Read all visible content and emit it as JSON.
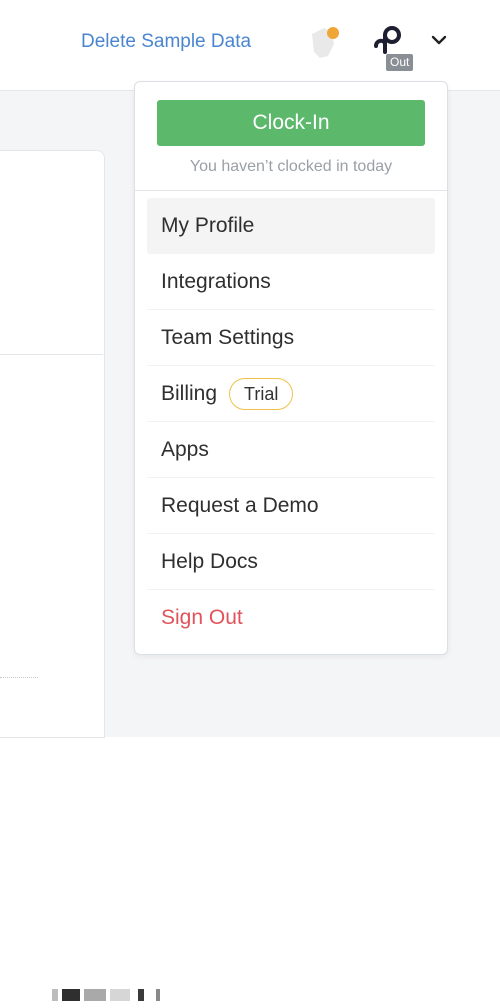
{
  "header": {
    "delete_sample_data": "Delete Sample Data",
    "status_badge": "Out",
    "icons": {
      "notification": "notification-bell-icon",
      "avatar": "pipedrive-logo-icon",
      "caret": "chevron-down-icon"
    },
    "notification_dot_color": "#f0a537"
  },
  "dropdown": {
    "clock_in_label": "Clock-In",
    "clock_in_subtext": "You haven’t clocked in today",
    "items": [
      {
        "label": "My Profile"
      },
      {
        "label": "Integrations"
      },
      {
        "label": "Team Settings"
      },
      {
        "label": "Billing",
        "badge": "Trial"
      },
      {
        "label": "Apps"
      },
      {
        "label": "Request a Demo"
      },
      {
        "label": "Help Docs"
      },
      {
        "label": "Sign Out"
      }
    ]
  },
  "colors": {
    "link": "#4a86cf",
    "clock_in_button": "#5cb96c",
    "sign_out": "#e0535a",
    "trial_border": "#f0c24a"
  }
}
